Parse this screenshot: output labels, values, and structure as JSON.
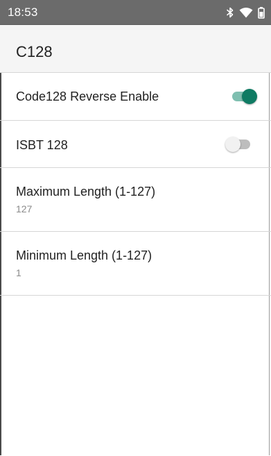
{
  "status_bar": {
    "time": "18:53",
    "icons": [
      "bluetooth-icon",
      "wifi-icon",
      "battery-icon"
    ]
  },
  "app_bar": {
    "title": "C128"
  },
  "preferences": [
    {
      "title": "Code128 Reverse Enable",
      "type": "switch",
      "checked": true
    },
    {
      "title": "ISBT 128",
      "type": "switch",
      "checked": false
    },
    {
      "title": "Maximum Length (1-127)",
      "type": "value",
      "summary": "127"
    },
    {
      "title": "Minimum Length (1-127)",
      "type": "value",
      "summary": "1"
    }
  ],
  "colors": {
    "status_bar_bg": "#6b6b6b",
    "app_bar_bg": "#f5f5f5",
    "switch_on_thumb": "#0f7b63",
    "switch_on_track": "#7fbfb0",
    "switch_off_thumb": "#f1f1f1",
    "switch_off_track": "#bdbdbd"
  }
}
